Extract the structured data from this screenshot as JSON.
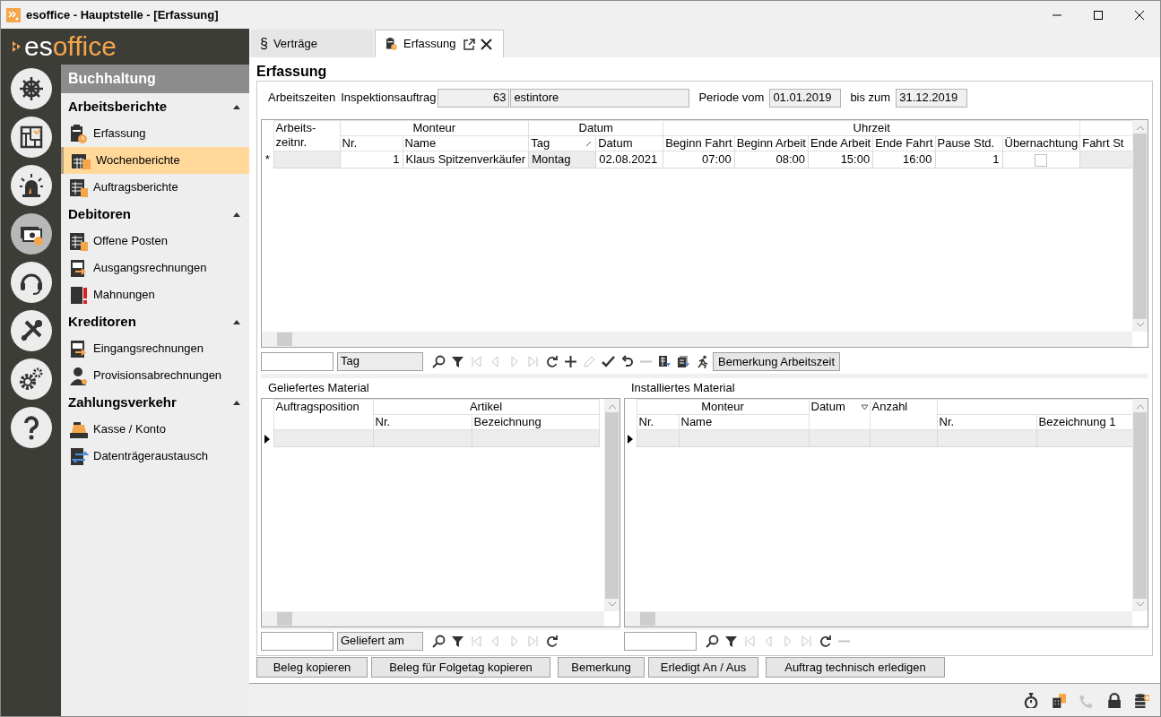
{
  "window": {
    "title": "esoffice - Hauptstelle - [Erfassung]"
  },
  "logo": {
    "part_1": "es",
    "part_2": "office"
  },
  "rail": [
    {
      "kind": "helm",
      "selected": false
    },
    {
      "kind": "plan",
      "selected": false
    },
    {
      "kind": "alarm",
      "selected": false
    },
    {
      "kind": "money",
      "selected": true
    },
    {
      "kind": "support",
      "selected": false
    },
    {
      "kind": "tools",
      "selected": false
    },
    {
      "kind": "settings",
      "selected": false
    },
    {
      "kind": "help",
      "selected": false
    }
  ],
  "nav": {
    "title": "Buchhaltung",
    "sections": [
      {
        "title": "Arbeitsberichte",
        "expanded": true,
        "items": [
          {
            "label": "Erfassung",
            "kind": "clipboard",
            "selected": false
          },
          {
            "label": "Wochenberichte",
            "kind": "calendar",
            "selected": true
          },
          {
            "label": "Auftragsberichte",
            "kind": "sheet",
            "selected": false
          }
        ]
      },
      {
        "title": "Debitoren",
        "expanded": true,
        "items": [
          {
            "label": "Offene Posten",
            "kind": "sheet",
            "selected": false
          },
          {
            "label": "Ausgangsrechnungen",
            "kind": "invoice",
            "selected": false
          },
          {
            "label": "Mahnungen",
            "kind": "warning",
            "selected": false
          }
        ]
      },
      {
        "title": "Kreditoren",
        "expanded": true,
        "items": [
          {
            "label": "Eingangsrechnungen",
            "kind": "invoice",
            "selected": false
          },
          {
            "label": "Provisionsabrechnungen",
            "kind": "person",
            "selected": false
          }
        ]
      },
      {
        "title": "Zahlungsverkehr",
        "expanded": true,
        "items": [
          {
            "label": "Kasse / Konto",
            "kind": "register",
            "selected": false
          },
          {
            "label": "Datenträgeraustausch",
            "kind": "exchange",
            "selected": false
          }
        ]
      }
    ]
  },
  "tabs": [
    {
      "symbol": "§",
      "label": "Verträge",
      "selected": false
    },
    {
      "label": "Erfassung",
      "selected": true
    }
  ],
  "page_title": "Erfassung",
  "header": {
    "label": "Arbeitszeiten",
    "order_label": "Inspektionsauftrag",
    "order_number": "63",
    "order_name": "estintore",
    "period_from_label": "Periode vom",
    "period_from": "01.01.2019",
    "period_to_label": "bis zum",
    "period_to": "31.12.2019"
  },
  "grids": [
    {
      "groups": [
        {
          "kind": "tall",
          "columns": [
            {
              "label": "Arbeits-zeitnr.",
              "sorted": false
            }
          ]
        },
        {
          "kind": "stacked",
          "label": "Monteur",
          "columns": [
            {
              "label": "Nr.",
              "sorted": false
            },
            {
              "label": "Name",
              "sorted": false
            }
          ]
        },
        {
          "kind": "stacked",
          "label": "Datum",
          "columns": [
            {
              "label": "Tag",
              "sorted": true
            },
            {
              "label": "Datum",
              "sorted": false
            }
          ]
        },
        {
          "kind": "stacked",
          "label": "Uhrzeit",
          "columns": [
            {
              "label": "Beginn Fahrt",
              "sorted": false
            },
            {
              "label": "Beginn Arbeit",
              "sorted": false
            },
            {
              "label": "Ende Arbeit",
              "sorted": false
            },
            {
              "label": "Ende Fahrt",
              "sorted": false
            },
            {
              "label": "Pause Std.",
              "sorted": false
            },
            {
              "label": "Übernachtung",
              "sorted": false
            }
          ]
        },
        {
          "kind": "stacked",
          "columns": [
            {
              "label": "Fahrt St",
              "sorted": false
            }
          ]
        }
      ],
      "rows": [
        {
          "marker": "*",
          "current": false,
          "cells": [
            {
              "kind": "readonly"
            },
            {
              "kind": "number",
              "text": "1"
            },
            {
              "kind": "text",
              "text": "Klaus Spitzenverkäufer"
            },
            {
              "kind": "readonly",
              "text": "Montag"
            },
            {
              "kind": "text",
              "text": "02.08.2021"
            },
            {
              "kind": "number",
              "text": "07:00"
            },
            {
              "kind": "number",
              "text": "08:00"
            },
            {
              "kind": "number",
              "text": "15:00"
            },
            {
              "kind": "number",
              "text": "16:00"
            },
            {
              "kind": "number",
              "text": "1"
            },
            {
              "kind": "check",
              "checked": false
            },
            {
              "kind": "readonly"
            }
          ]
        }
      ]
    },
    {
      "title": "Geliefertes Material",
      "groups": [
        {
          "kind": "tall",
          "columns": [
            {
              "label": "Auftragsposition",
              "sorted": false
            }
          ]
        },
        {
          "kind": "stacked",
          "label": "Artikel",
          "columns": [
            {
              "label": "Nr.",
              "sorted": false
            },
            {
              "label": "Bezeichnung",
              "sorted": false
            }
          ]
        }
      ],
      "rows": [
        {
          "current": true,
          "cells": [
            {
              "kind": "readonly"
            },
            {
              "kind": "readonly"
            },
            {
              "kind": "readonly"
            }
          ]
        }
      ]
    },
    {
      "title": "Installiertes Material",
      "groups": [
        {
          "kind": "stacked",
          "label": "Monteur",
          "columns": [
            {
              "label": "Nr.",
              "sorted": false
            },
            {
              "label": "Name",
              "sorted": false
            }
          ]
        },
        {
          "kind": "tall",
          "columns": [
            {
              "label": "Datum",
              "sorted": true
            }
          ]
        },
        {
          "kind": "tall",
          "columns": [
            {
              "label": "Anzahl",
              "sorted": false
            }
          ]
        },
        {
          "kind": "stacked",
          "columns": [
            {
              "label": "Nr.",
              "sorted": false
            },
            {
              "label": "Bezeichnung 1",
              "sorted": false
            }
          ]
        }
      ],
      "rows": [
        {
          "current": true,
          "cells": [
            {
              "kind": "readonly"
            },
            {
              "kind": "readonly"
            },
            {
              "kind": "readonly"
            },
            {
              "kind": "readonly"
            },
            {
              "kind": "readonly"
            },
            {
              "kind": "readonly"
            }
          ]
        }
      ]
    }
  ],
  "toolbars": [
    {
      "column_field": "Tag",
      "tools": [
        {
          "kind": "search",
          "disabled": false
        },
        {
          "kind": "filter",
          "disabled": false
        },
        {
          "kind": "first",
          "disabled": true
        },
        {
          "kind": "prev",
          "disabled": true
        },
        {
          "kind": "next",
          "disabled": true
        },
        {
          "kind": "last",
          "disabled": true
        },
        {
          "kind": "refresh",
          "disabled": false
        },
        {
          "kind": "add",
          "disabled": false
        },
        {
          "kind": "edit",
          "disabled": true
        },
        {
          "kind": "save",
          "disabled": false
        },
        {
          "kind": "undo",
          "disabled": false
        },
        {
          "kind": "remove",
          "disabled": true
        },
        {
          "kind": "export",
          "disabled": false
        },
        {
          "kind": "export2",
          "disabled": false
        },
        {
          "kind": "run",
          "disabled": false
        }
      ],
      "button": "Bemerkung Arbeitszeit"
    },
    {
      "column_field": "Geliefert am",
      "tools": [
        {
          "kind": "search",
          "disabled": false
        },
        {
          "kind": "filter",
          "disabled": false
        },
        {
          "kind": "first",
          "disabled": true
        },
        {
          "kind": "prev",
          "disabled": true
        },
        {
          "kind": "next",
          "disabled": true
        },
        {
          "kind": "last",
          "disabled": true
        },
        {
          "kind": "refresh",
          "disabled": false
        }
      ]
    },
    {
      "tools": [
        {
          "kind": "search",
          "disabled": false
        },
        {
          "kind": "filter",
          "disabled": false
        },
        {
          "kind": "first",
          "disabled": true
        },
        {
          "kind": "prev",
          "disabled": true
        },
        {
          "kind": "next",
          "disabled": true
        },
        {
          "kind": "last",
          "disabled": true
        },
        {
          "kind": "refresh",
          "disabled": false
        },
        {
          "kind": "remove",
          "disabled": true
        }
      ]
    }
  ],
  "buttons": [
    "Beleg kopieren",
    "Beleg für Folgetag kopieren",
    "Bemerkung",
    "Erledigt An / Aus",
    "Auftrag technisch erledigen"
  ],
  "status_icons": [
    {
      "kind": "stopwatch",
      "disabled": false
    },
    {
      "kind": "buildings",
      "disabled": false
    },
    {
      "kind": "phone",
      "disabled": true
    },
    {
      "kind": "lock",
      "disabled": false
    },
    {
      "kind": "database",
      "disabled": false
    }
  ]
}
